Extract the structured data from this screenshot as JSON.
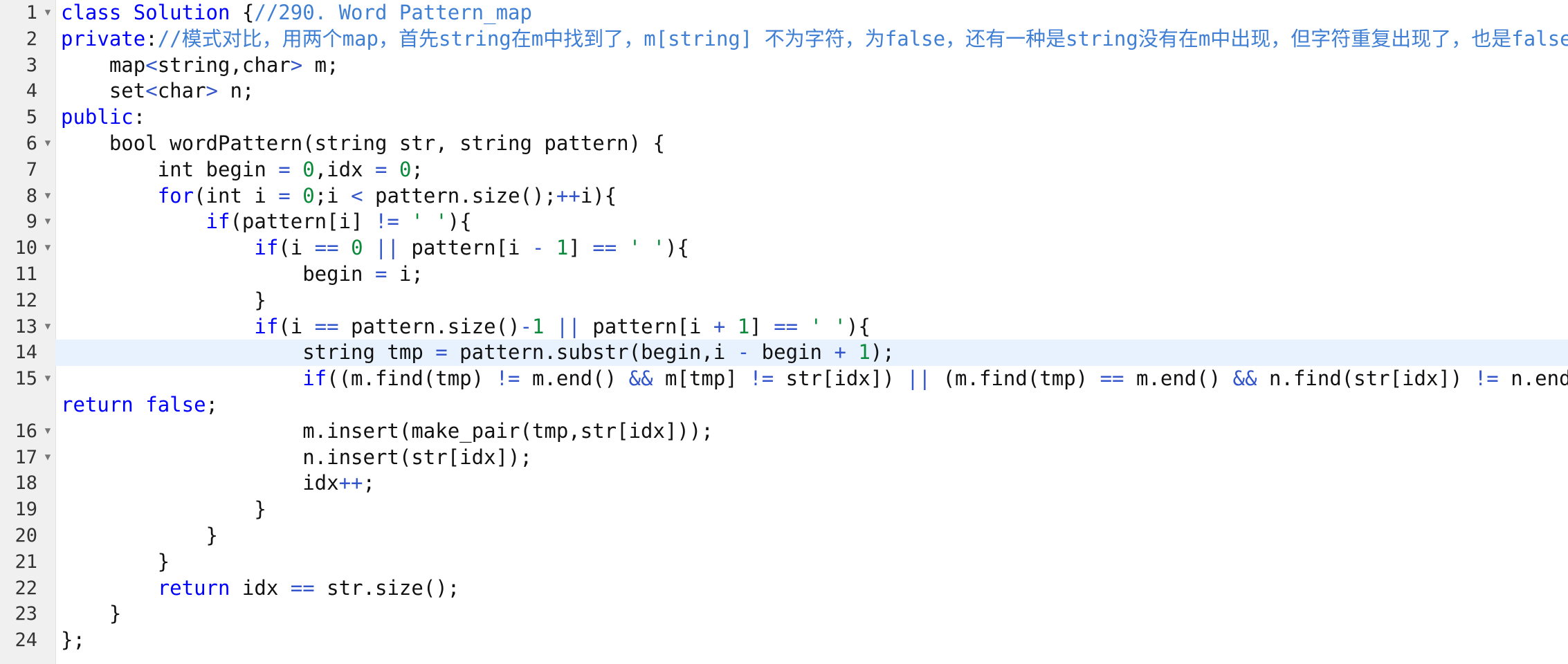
{
  "editor": {
    "colors": {
      "keyword": "#0000ff",
      "comment": "#3f7fd4",
      "number": "#0a8a3a",
      "string": "#0a8a3a",
      "operator": "#3355cc",
      "text": "#111111",
      "active_line": "#e8f2ff",
      "gutter": "#f0f0f0"
    },
    "fold_icon": "chevron-down-icon",
    "active_line": 14,
    "lines": [
      {
        "n": "1",
        "fold": true,
        "tokens": [
          [
            "kw",
            "class Solution "
          ],
          [
            "tx",
            "{"
          ],
          [
            "cm",
            "//290. Word Pattern_map"
          ]
        ]
      },
      {
        "n": "2",
        "fold": false,
        "tokens": [
          [
            "kw",
            "private"
          ],
          [
            "tx",
            ":"
          ],
          [
            "cm",
            "//模式对比，用两个map，首先string在m中找到了，m[string] 不为字符，为false，还有一种是string没有在m中出现，但字符重复出现了，也是false。"
          ]
        ]
      },
      {
        "n": "3",
        "fold": false,
        "tokens": [
          [
            "tx",
            "    map"
          ],
          [
            "op",
            "<"
          ],
          [
            "tx",
            "string,char"
          ],
          [
            "op",
            ">"
          ],
          [
            "tx",
            " m;"
          ]
        ]
      },
      {
        "n": "4",
        "fold": false,
        "tokens": [
          [
            "tx",
            "    set"
          ],
          [
            "op",
            "<"
          ],
          [
            "tx",
            "char"
          ],
          [
            "op",
            ">"
          ],
          [
            "tx",
            " n;"
          ]
        ]
      },
      {
        "n": "5",
        "fold": false,
        "tokens": [
          [
            "kw",
            "public"
          ],
          [
            "tx",
            ":"
          ]
        ]
      },
      {
        "n": "6",
        "fold": true,
        "tokens": [
          [
            "tx",
            "    bool wordPattern(string str, string pattern) {"
          ]
        ]
      },
      {
        "n": "7",
        "fold": false,
        "tokens": [
          [
            "tx",
            "        int begin "
          ],
          [
            "op",
            "="
          ],
          [
            "tx",
            " "
          ],
          [
            "num",
            "0"
          ],
          [
            "tx",
            ",idx "
          ],
          [
            "op",
            "="
          ],
          [
            "tx",
            " "
          ],
          [
            "num",
            "0"
          ],
          [
            "tx",
            ";"
          ]
        ]
      },
      {
        "n": "8",
        "fold": true,
        "tokens": [
          [
            "tx",
            "        "
          ],
          [
            "kw",
            "for"
          ],
          [
            "tx",
            "(int i "
          ],
          [
            "op",
            "="
          ],
          [
            "tx",
            " "
          ],
          [
            "num",
            "0"
          ],
          [
            "tx",
            ";i "
          ],
          [
            "op",
            "<"
          ],
          [
            "tx",
            " pattern.size();"
          ],
          [
            "op",
            "++"
          ],
          [
            "tx",
            "i){"
          ]
        ]
      },
      {
        "n": "9",
        "fold": true,
        "tokens": [
          [
            "tx",
            "            "
          ],
          [
            "kw",
            "if"
          ],
          [
            "tx",
            "(pattern[i] "
          ],
          [
            "op",
            "!="
          ],
          [
            "tx",
            " "
          ],
          [
            "str",
            "' '"
          ],
          [
            "tx",
            "){"
          ]
        ]
      },
      {
        "n": "10",
        "fold": true,
        "tokens": [
          [
            "tx",
            "                "
          ],
          [
            "kw",
            "if"
          ],
          [
            "tx",
            "(i "
          ],
          [
            "op",
            "=="
          ],
          [
            "tx",
            " "
          ],
          [
            "num",
            "0"
          ],
          [
            "tx",
            " "
          ],
          [
            "op",
            "||"
          ],
          [
            "tx",
            " pattern[i "
          ],
          [
            "op",
            "-"
          ],
          [
            "tx",
            " "
          ],
          [
            "num",
            "1"
          ],
          [
            "tx",
            "] "
          ],
          [
            "op",
            "=="
          ],
          [
            "tx",
            " "
          ],
          [
            "str",
            "' '"
          ],
          [
            "tx",
            "){"
          ]
        ]
      },
      {
        "n": "11",
        "fold": false,
        "tokens": [
          [
            "tx",
            "                    begin "
          ],
          [
            "op",
            "="
          ],
          [
            "tx",
            " i;"
          ]
        ]
      },
      {
        "n": "12",
        "fold": false,
        "tokens": [
          [
            "tx",
            "                }"
          ]
        ]
      },
      {
        "n": "13",
        "fold": true,
        "tokens": [
          [
            "tx",
            "                "
          ],
          [
            "kw",
            "if"
          ],
          [
            "tx",
            "(i "
          ],
          [
            "op",
            "=="
          ],
          [
            "tx",
            " pattern.size()"
          ],
          [
            "op",
            "-"
          ],
          [
            "num",
            "1"
          ],
          [
            "tx",
            " "
          ],
          [
            "op",
            "||"
          ],
          [
            "tx",
            " pattern[i "
          ],
          [
            "op",
            "+"
          ],
          [
            "tx",
            " "
          ],
          [
            "num",
            "1"
          ],
          [
            "tx",
            "] "
          ],
          [
            "op",
            "=="
          ],
          [
            "tx",
            " "
          ],
          [
            "str",
            "' '"
          ],
          [
            "tx",
            "){"
          ]
        ]
      },
      {
        "n": "14",
        "fold": false,
        "tokens": [
          [
            "tx",
            "                    string tmp "
          ],
          [
            "op",
            "="
          ],
          [
            "tx",
            " pattern.substr(begin,i "
          ],
          [
            "op",
            "-"
          ],
          [
            "tx",
            " begin "
          ],
          [
            "op",
            "+"
          ],
          [
            "tx",
            " "
          ],
          [
            "num",
            "1"
          ],
          [
            "tx",
            ");"
          ]
        ]
      },
      {
        "n": "15",
        "fold": true,
        "wrap": true,
        "tokens": [
          [
            "tx",
            "                    "
          ],
          [
            "kw",
            "if"
          ],
          [
            "tx",
            "((m.find(tmp) "
          ],
          [
            "op",
            "!="
          ],
          [
            "tx",
            " m.end() "
          ],
          [
            "op",
            "&&"
          ],
          [
            "tx",
            " m[tmp] "
          ],
          [
            "op",
            "!="
          ],
          [
            "tx",
            " str[idx]) "
          ],
          [
            "op",
            "||"
          ],
          [
            "tx",
            " (m.find(tmp) "
          ],
          [
            "op",
            "=="
          ],
          [
            "tx",
            " m.end() "
          ],
          [
            "op",
            "&&"
          ],
          [
            "tx",
            " n.find(str[idx]) "
          ],
          [
            "op",
            "!="
          ],
          [
            "tx",
            " n.end()))\n"
          ],
          [
            "kw",
            "return"
          ],
          [
            "tx",
            " "
          ],
          [
            "kw",
            "false"
          ],
          [
            "tx",
            ";"
          ]
        ]
      },
      {
        "n": "16",
        "fold": true,
        "tokens": [
          [
            "tx",
            "                    m.insert(make_pair(tmp,str[idx]));"
          ]
        ]
      },
      {
        "n": "17",
        "fold": true,
        "tokens": [
          [
            "tx",
            "                    n.insert(str[idx]);"
          ]
        ]
      },
      {
        "n": "18",
        "fold": false,
        "tokens": [
          [
            "tx",
            "                    idx"
          ],
          [
            "op",
            "++"
          ],
          [
            "tx",
            ";"
          ]
        ]
      },
      {
        "n": "19",
        "fold": false,
        "tokens": [
          [
            "tx",
            "                }"
          ]
        ]
      },
      {
        "n": "20",
        "fold": false,
        "tokens": [
          [
            "tx",
            "            }"
          ]
        ]
      },
      {
        "n": "21",
        "fold": false,
        "tokens": [
          [
            "tx",
            "        }"
          ]
        ]
      },
      {
        "n": "22",
        "fold": false,
        "tokens": [
          [
            "tx",
            "        "
          ],
          [
            "kw",
            "return"
          ],
          [
            "tx",
            " idx "
          ],
          [
            "op",
            "=="
          ],
          [
            "tx",
            " str.size();"
          ]
        ]
      },
      {
        "n": "23",
        "fold": false,
        "tokens": [
          [
            "tx",
            "    }"
          ]
        ]
      },
      {
        "n": "24",
        "fold": false,
        "tokens": [
          [
            "tx",
            "};"
          ]
        ]
      }
    ]
  }
}
